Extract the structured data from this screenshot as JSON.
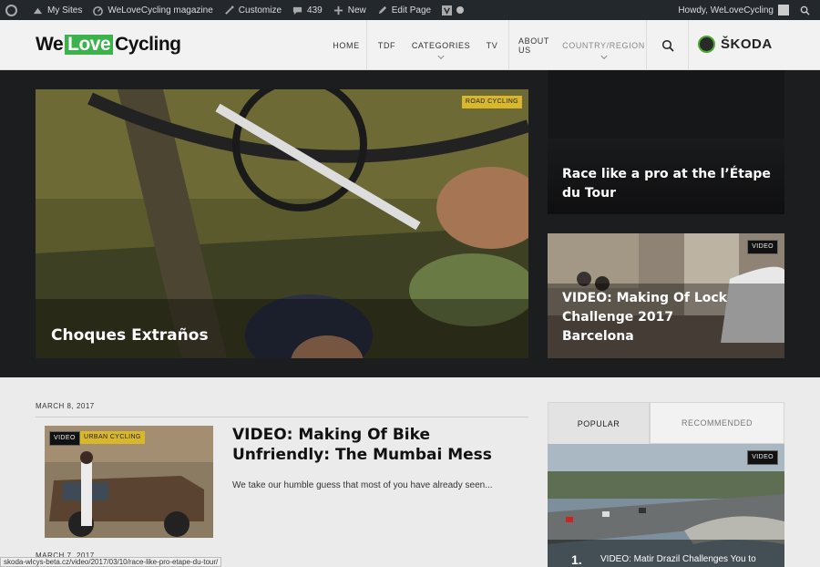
{
  "adminbar": {
    "my_sites": "My Sites",
    "site_name": "WeLoveCycling magazine",
    "customize": "Customize",
    "comments_count": "439",
    "new": "New",
    "edit_page": "Edit Page",
    "howdy": "Howdy, WeLoveCycling"
  },
  "header": {
    "logo_we": "We",
    "logo_love": "Love",
    "logo_cycling": "Cycling",
    "nav": [
      "HOME",
      "TDF",
      "CATEGORIES",
      "TV",
      "ABOUT US",
      "COUNTRY/REGION"
    ],
    "sponsor": "ŠKODA"
  },
  "hero": {
    "main": {
      "tag": "ROAD CYCLING",
      "title": "Choques Extraños"
    },
    "side1": {
      "title": "Race like a pro at the l’Étape du Tour"
    },
    "side2": {
      "tag": "VIDEO",
      "title": "VIDEO: Making Of Lock Challenge 2017 Barcelona"
    }
  },
  "articles": [
    {
      "date": "MARCH 8, 2017",
      "tags": [
        "VIDEO",
        "URBAN CYCLING"
      ],
      "title": "VIDEO: Making Of Bike Unfriendly: The Mumbai Mess",
      "excerpt": "We take our humble guess that most of you have already seen..."
    }
  ],
  "next_date": "MARCH 7, 2017",
  "sidebar": {
    "tabs": [
      "POPULAR",
      "RECOMMENDED"
    ],
    "popular": {
      "tag": "VIDEO",
      "num": "1.",
      "title": "VIDEO: Matir Drazil Challenges You to"
    }
  },
  "status_url": "skoda-wlcys-beta.cz/video/2017/03/10/race-like-pro-etape-du-tour/",
  "colors": {
    "brand_green": "#3cb34a",
    "tag_yellow": "#d9b72a",
    "adminbar": "#23282d"
  }
}
